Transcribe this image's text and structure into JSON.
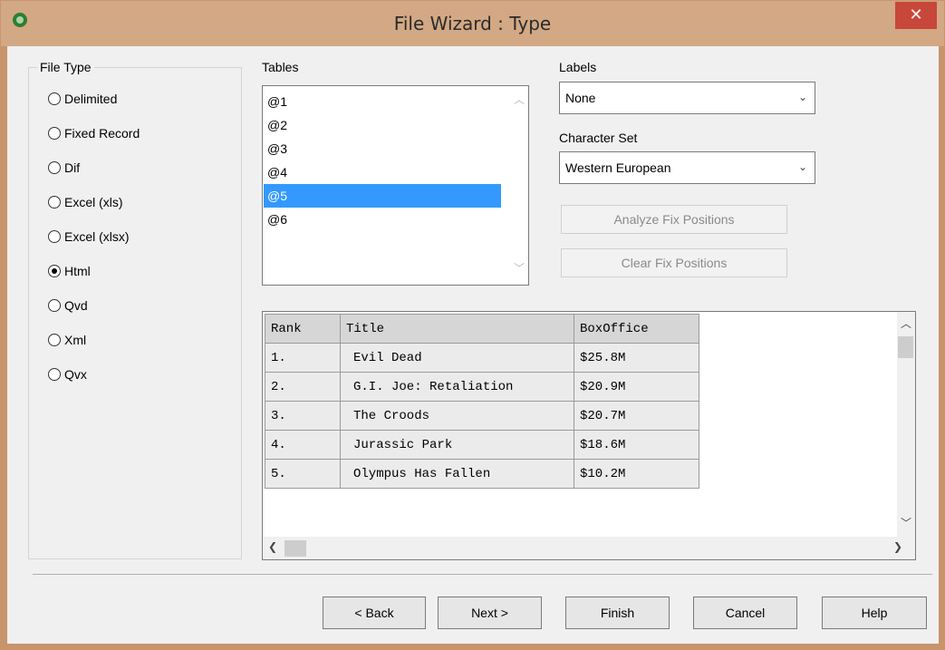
{
  "window": {
    "title": "File Wizard : Type",
    "close_glyph": "✕",
    "app_icon": "qlikview-icon"
  },
  "file_type": {
    "legend": "File Type",
    "options": [
      {
        "label": "Delimited",
        "selected": false
      },
      {
        "label": "Fixed Record",
        "selected": false
      },
      {
        "label": "Dif",
        "selected": false
      },
      {
        "label": "Excel (xls)",
        "selected": false
      },
      {
        "label": "Excel (xlsx)",
        "selected": false
      },
      {
        "label": "Html",
        "selected": true
      },
      {
        "label": "Qvd",
        "selected": false
      },
      {
        "label": "Xml",
        "selected": false
      },
      {
        "label": "Qvx",
        "selected": false
      }
    ]
  },
  "tables": {
    "label": "Tables",
    "items": [
      "@1",
      "@2",
      "@3",
      "@4",
      "@5",
      "@6"
    ],
    "selected": "@5"
  },
  "labels": {
    "label": "Labels",
    "value": "None"
  },
  "character_set": {
    "label": "Character Set",
    "value": "Western European"
  },
  "buttons_fix": {
    "analyze": "Analyze Fix Positions",
    "clear": "Clear Fix Positions"
  },
  "preview": {
    "columns": [
      "Rank",
      "Title",
      "BoxOffice"
    ],
    "rows": [
      [
        "1.",
        "Evil Dead",
        "$25.8M"
      ],
      [
        "2.",
        "G.I. Joe: Retaliation",
        "$20.9M"
      ],
      [
        "3.",
        "The Croods",
        "$20.7M"
      ],
      [
        "4.",
        "Jurassic Park",
        "$18.6M"
      ],
      [
        "5.",
        "Olympus Has Fallen",
        "$10.2M"
      ]
    ]
  },
  "footer": {
    "back": "< Back",
    "next": "Next >",
    "finish": "Finish",
    "cancel": "Cancel",
    "help": "Help"
  },
  "colors": {
    "titlebar": "#d3a884",
    "selection": "#3399ff",
    "close": "#c7473a"
  }
}
